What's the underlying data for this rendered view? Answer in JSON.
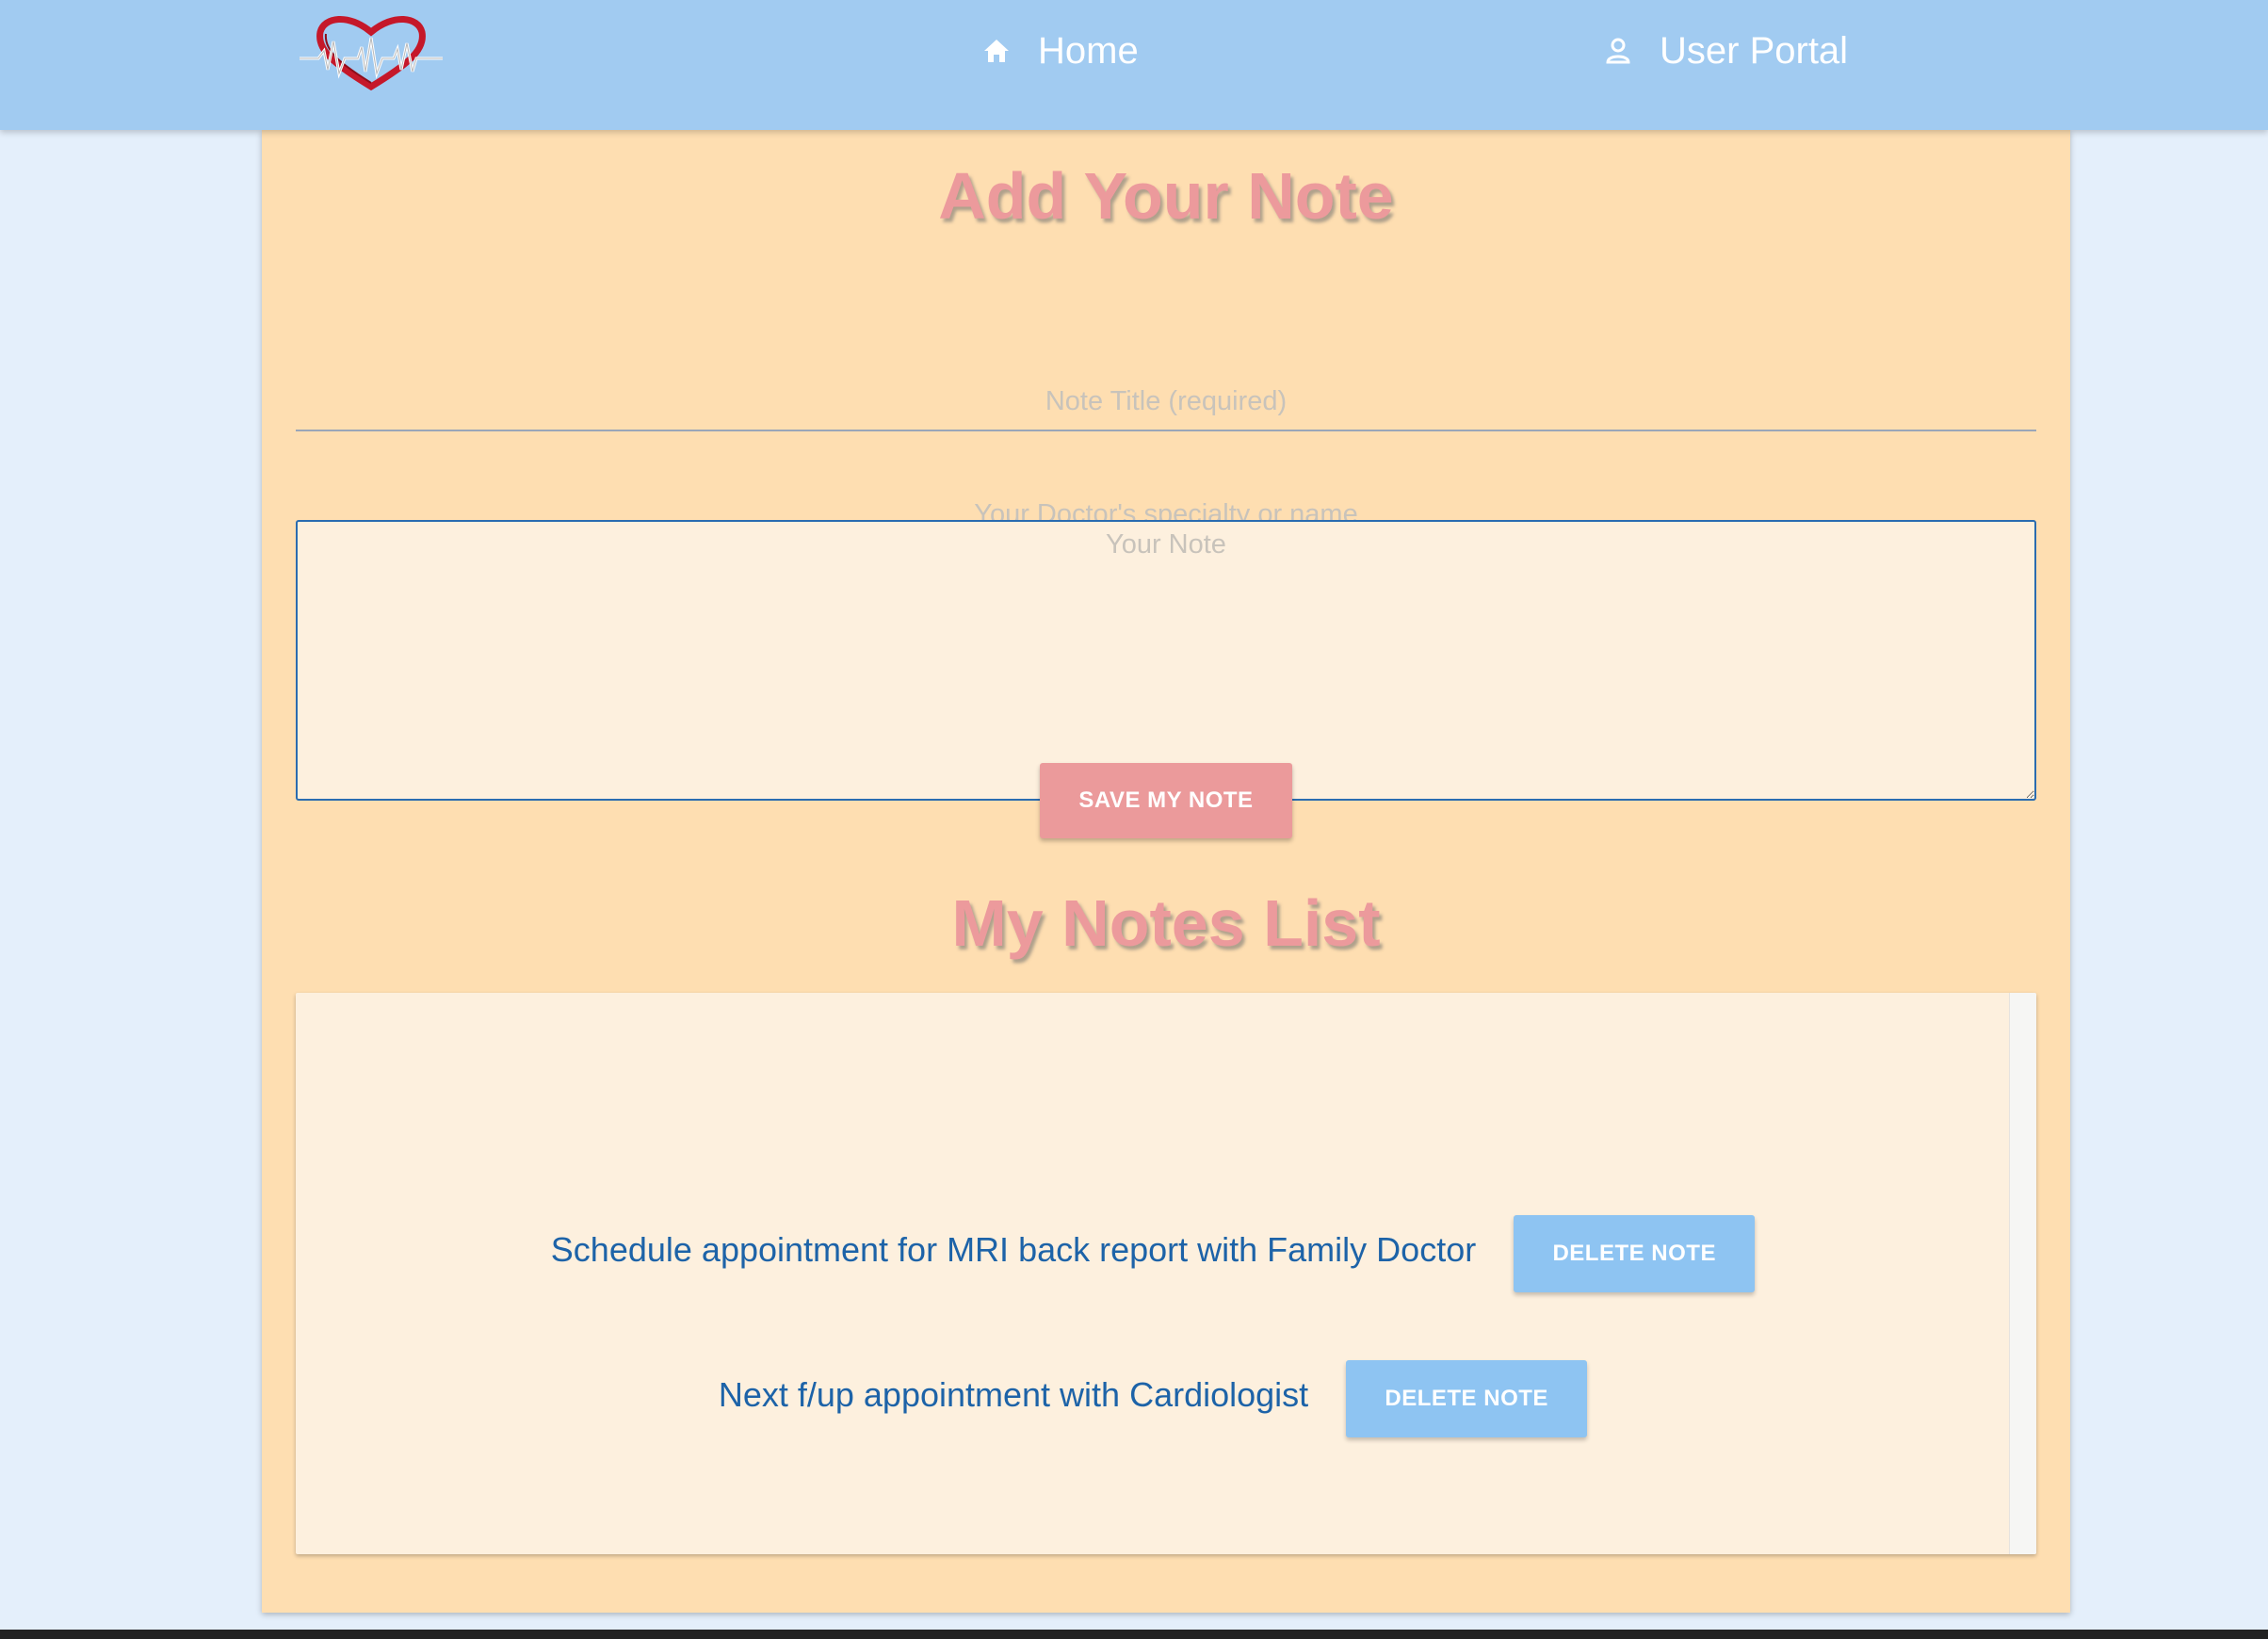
{
  "nav": {
    "logo_icon": "heart-ecg-logo",
    "home_label": "Home",
    "home_icon": "home-icon",
    "portal_label": "User Portal",
    "portal_icon": "user-icon"
  },
  "form": {
    "heading": "Add Your Note",
    "title_placeholder": "Note Title (required)",
    "doctor_placeholder": "Your Doctor's specialty or name",
    "note_placeholder": "Your Note",
    "save_label": "SAVE MY NOTE"
  },
  "list": {
    "heading": "My Notes List",
    "notes": [
      {
        "text": "Schedule appointment for MRI back report with Family Doctor",
        "delete_label": "DELETE NOTE"
      },
      {
        "text": "Next f/up appointment with Cardiologist",
        "delete_label": "DELETE NOTE"
      }
    ]
  },
  "colors": {
    "navbar": "#a1cbf1",
    "card": "#fedeb1",
    "heading": "#ec9a9c",
    "note_text": "#1d63a8",
    "delete_button": "#8ec4f2",
    "save_button": "#eb9a9b"
  }
}
